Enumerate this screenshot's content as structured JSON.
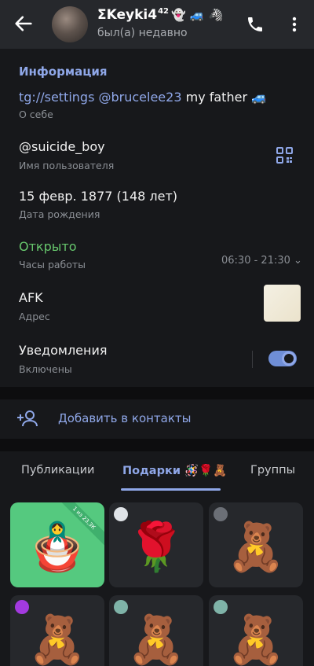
{
  "header": {
    "title": "ΣKeyki4",
    "title_sup": "42",
    "title_emoji": "👻 🚙 🦓",
    "subtitle": "был(а) недавно",
    "back_icon": "arrow-left-icon",
    "call_icon": "phone-icon",
    "more_icon": "more-vertical-icon"
  },
  "info": {
    "section_title": "Информация",
    "bio": {
      "link1": "tg://settings",
      "link2": "@brucelee23",
      "text": " my father 🚙",
      "label": "О себе"
    },
    "username": {
      "value": "@suicide_boy",
      "label": "Имя пользователя"
    },
    "birthday": {
      "value": "15 февр. 1877 (148 лет)",
      "label": "Дата рождения"
    },
    "hours": {
      "value": "Открыто",
      "label": "Часы работы",
      "range": "06:30 - 21:30 ⌄"
    },
    "address": {
      "value": "AFK",
      "label": "Адрес"
    },
    "notifications": {
      "value": "Уведомления",
      "label": "Включены",
      "enabled": true
    }
  },
  "add_contact": {
    "label": "Добавить в контакты"
  },
  "tabs": [
    {
      "label": "Публикации",
      "active": false
    },
    {
      "label": "Подарки 🪅🌹🧸",
      "active": true
    },
    {
      "label": "Группы",
      "active": false
    }
  ],
  "gifts": [
    {
      "glyph": "🪆",
      "ribbon": "1 из 23,3К"
    },
    {
      "glyph": "🌹"
    },
    {
      "glyph": "🧸"
    },
    {
      "glyph": "🧸"
    },
    {
      "glyph": "🧸"
    },
    {
      "glyph": "🧸"
    }
  ],
  "colors": {
    "accent": "#8fa7e8",
    "open_green": "#67c76d",
    "bg": "#17181b",
    "header_bg": "#26282c"
  }
}
